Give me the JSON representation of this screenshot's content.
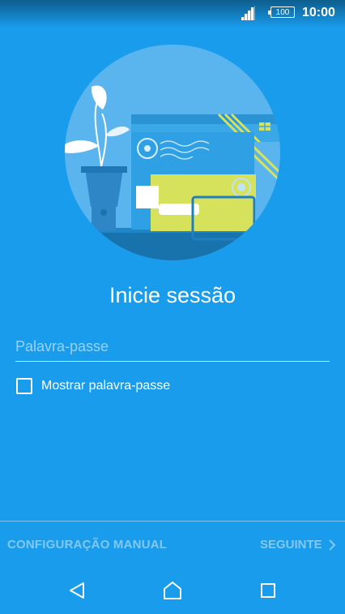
{
  "status_bar": {
    "battery": "100",
    "time": "10:00",
    "icons": [
      "signal-icon",
      "battery-icon"
    ]
  },
  "hero": {
    "icon": "mail-illustration"
  },
  "login": {
    "title": "Inicie sessão",
    "password_placeholder": "Palavra-passe",
    "password_value": "",
    "show_password_label": "Mostrar palavra-passe",
    "show_password_checked": false
  },
  "footer": {
    "manual_label": "CONFIGURAÇÃO MANUAL",
    "next_label": "SEGUINTE",
    "next_icon": "chevron-right-icon"
  },
  "nav": {
    "icons": [
      "back-icon",
      "home-icon",
      "recents-icon"
    ]
  },
  "colors": {
    "background": "#1a9cec",
    "hero_circle": "#5ab4ee",
    "accent_yellow": "#d6e25c"
  }
}
